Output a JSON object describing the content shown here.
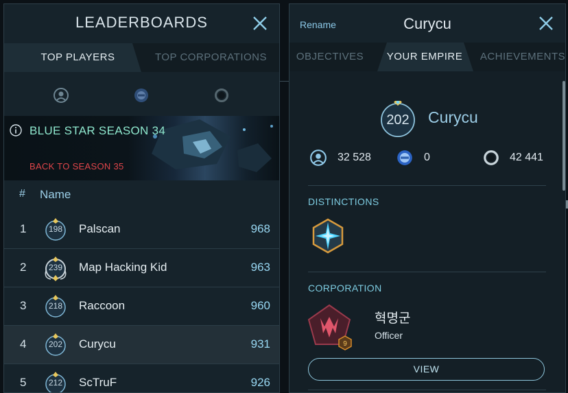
{
  "leaderboards": {
    "title": "LEADERBOARDS",
    "tabs": [
      {
        "label": "TOP PLAYERS",
        "active": true
      },
      {
        "label": "TOP CORPORATIONS",
        "active": false
      }
    ],
    "currency_icons": [
      "influence-icon",
      "blue-star-icon",
      "relic-icon"
    ],
    "banner": {
      "season": "BLUE STAR SEASON 34",
      "back_link": "BACK TO SEASON 35"
    },
    "columns": {
      "rank": "#",
      "name": "Name"
    },
    "players": [
      {
        "rank": "1",
        "level": "198",
        "name": "Palscan",
        "score": "968"
      },
      {
        "rank": "2",
        "level": "239",
        "name": "Map Hacking Kid",
        "score": "963"
      },
      {
        "rank": "3",
        "level": "218",
        "name": "Raccoon",
        "score": "960"
      },
      {
        "rank": "4",
        "level": "202",
        "name": "Curycu",
        "score": "931"
      },
      {
        "rank": "5",
        "level": "212",
        "name": "ScTruF",
        "score": "926"
      }
    ]
  },
  "empire": {
    "rename_label": "Rename",
    "title": "Curycu",
    "tabs": [
      {
        "label": "OBJECTIVES",
        "active": false
      },
      {
        "label": "YOUR EMPIRE",
        "active": true
      },
      {
        "label": "ACHIEVEMENTS",
        "active": false
      }
    ],
    "level": "202",
    "player_name": "Curycu",
    "stats": [
      {
        "icon": "influence-icon",
        "value": "32 528"
      },
      {
        "icon": "blue-star-icon",
        "value": "0"
      },
      {
        "icon": "relic-icon",
        "value": "42 441"
      }
    ],
    "distinctions_label": "DISTINCTIONS",
    "corporation_label": "CORPORATION",
    "corporation": {
      "name": "혁명군",
      "role": "Officer",
      "badge_level": "9"
    },
    "view_button": "VIEW"
  },
  "colors": {
    "accent_text": "#7ecde2",
    "season_text": "#8fe8ce",
    "back_link": "#e0454a",
    "score": "#98d7f2",
    "corp_emblem": "#e0566b"
  }
}
